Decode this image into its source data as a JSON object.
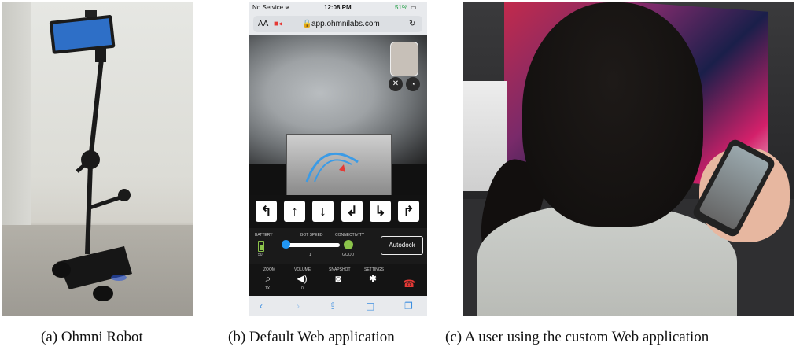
{
  "captions": {
    "a": "(a) Ohmni Robot",
    "b": "(b) Default Web application",
    "c": "(c) A user using the custom Web application"
  },
  "phone": {
    "status_carrier": "No Service",
    "status_time": "12:08 PM",
    "status_battery": "51%",
    "url_text_size": "AA",
    "url": "app.ohmnilabs.com",
    "direction_buttons": [
      "↰",
      "↑",
      "↓",
      "↲",
      "↳",
      "↱"
    ],
    "battery_label": "BATTERY",
    "battery_value": "50",
    "botspeed_label": "BOT SPEED",
    "botspeed_value": "1",
    "connectivity_label": "CONNECTIVITY",
    "connectivity_value": "GOOD",
    "autodock_label": "Autodock",
    "zoom_label": "ZOOM",
    "zoom_value": "1X",
    "volume_label": "VOLUME",
    "volume_value": "0",
    "snapshot_label": "SNAPSHOT",
    "settings_label": "SETTINGS"
  },
  "colors": {
    "connectivity_good": "#8bc34a",
    "speed_knob": "#2196f3",
    "hangup": "#e53935",
    "safari_accent": "#3d8fe0"
  },
  "icons": [
    "search-icon",
    "speaker-icon",
    "camera-icon",
    "gear-icon",
    "hangup-icon",
    "back-icon",
    "forward-icon",
    "share-icon",
    "bookmarks-icon",
    "tabs-icon"
  ]
}
